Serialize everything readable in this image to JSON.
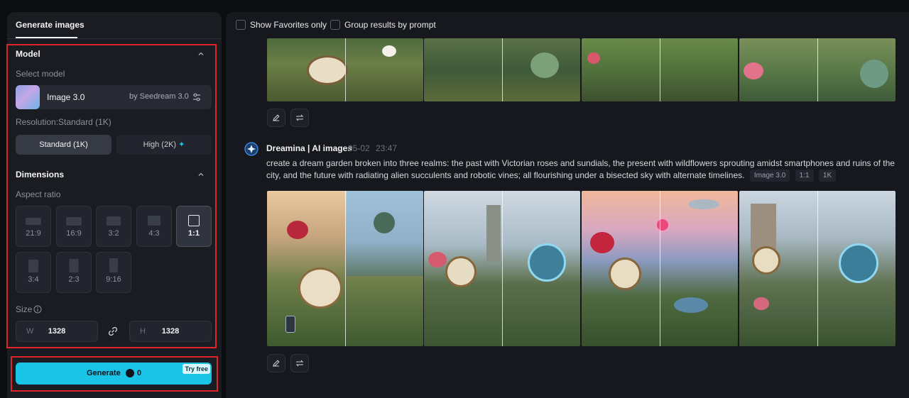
{
  "sidebar": {
    "tab_label": "Generate images",
    "model_section": {
      "title": "Model",
      "select_label": "Select model",
      "model_name": "Image 3.0",
      "model_by": "by Seedream 3.0",
      "resolution_label": "Resolution:Standard (1K)",
      "resolution_options": [
        {
          "label": "Standard (1K)",
          "selected": true
        },
        {
          "label": "High (2K)",
          "selected": false
        }
      ],
      "high_sparkle": "✦"
    },
    "dimensions_section": {
      "title": "Dimensions",
      "aspect_label": "Aspect ratio",
      "ratios": [
        "21:9",
        "16:9",
        "3:2",
        "4:3",
        "1:1",
        "3:4",
        "2:3",
        "9:16"
      ],
      "selected_ratio": "1:1",
      "size_label": "Size",
      "width_prefix": "W",
      "width_value": "1328",
      "height_prefix": "H",
      "height_value": "1328"
    },
    "generate": {
      "label": "Generate",
      "credits": "0",
      "badge": "Try free"
    }
  },
  "main": {
    "filters": {
      "favorites_label": "Show Favorites only",
      "group_label": "Group results by prompt"
    },
    "result": {
      "author": "Dreamina | AI images",
      "date": "05-02",
      "time": "23:47",
      "prompt": "create a dream garden broken into three realms: the past with Victorian roses and sundials, the present with wildflowers sprouting amidst smartphones and ruins of the city, and the future with radiating alien succulents and robotic vines; all flourishing under a bisected sky with alternate timelines.",
      "tags": [
        "Image 3.0",
        "1:1",
        "1K"
      ]
    }
  },
  "colors": {
    "accent": "#19c4e6",
    "highlight_border": "#e0242c",
    "panel": "#1a1c22"
  }
}
